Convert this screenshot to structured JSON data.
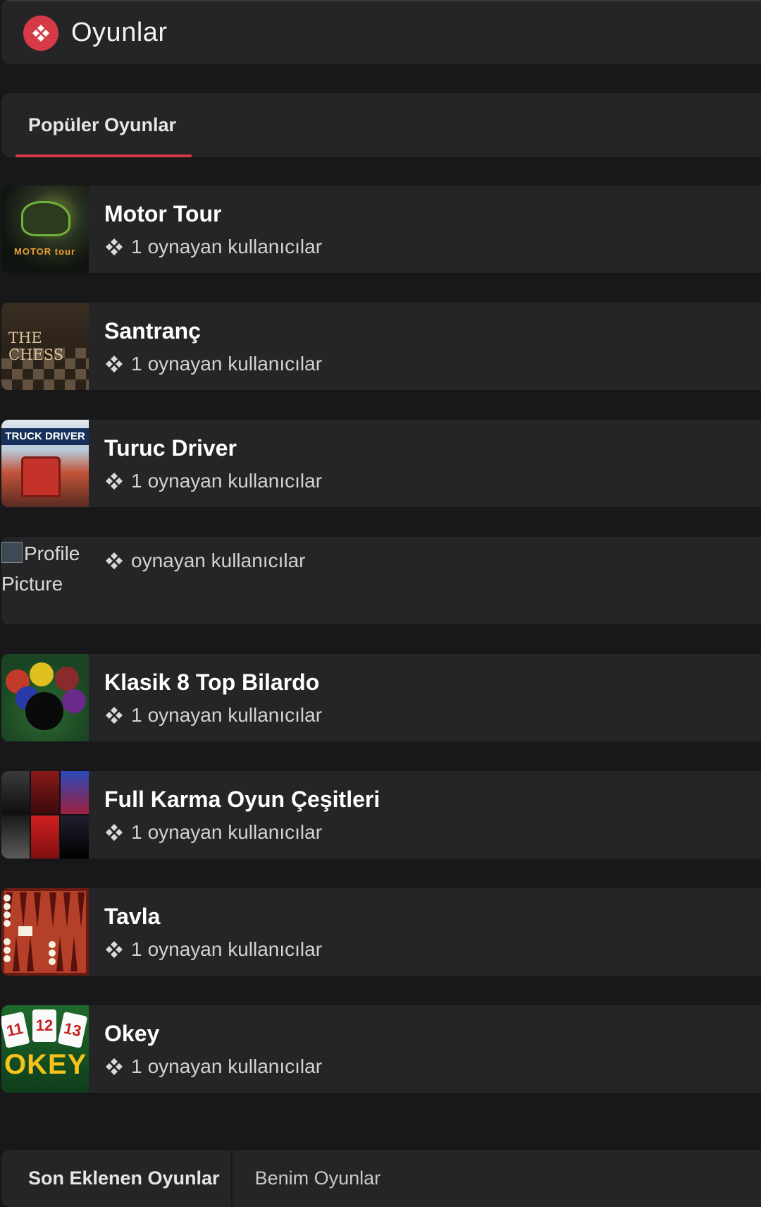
{
  "header": {
    "title": "Oyunlar",
    "icon": "gamepad-icon",
    "accent_color": "#d73a47"
  },
  "tabs_top": {
    "popular_label": "Popüler Oyunlar"
  },
  "games": [
    {
      "title": "Motor Tour",
      "count": "1",
      "players_label": "oynayan kullanıcılar"
    },
    {
      "title": "Santranç",
      "count": "1",
      "players_label": "oynayan kullanıcılar"
    },
    {
      "title": "Turuc Driver",
      "count": "1",
      "players_label": "oynayan kullanıcılar"
    },
    {
      "title": "",
      "count": "",
      "players_label": "oynayan kullanıcılar",
      "broken_image_alt": "Profile Picture"
    },
    {
      "title": "Klasik 8 Top Bilardo",
      "count": "1",
      "players_label": "oynayan kullanıcılar"
    },
    {
      "title": "Full Karma Oyun Çeşitleri",
      "count": "1",
      "players_label": "oynayan kullanıcılar"
    },
    {
      "title": "Tavla",
      "count": "1",
      "players_label": "oynayan kullanıcılar"
    },
    {
      "title": "Okey",
      "count": "1",
      "players_label": "oynayan kullanıcılar"
    }
  ],
  "thumb_text": {
    "motor": "MOTOR tour",
    "chess": "THE CHESS",
    "truck": "TRUCK DRIVER",
    "okey": "OKEY"
  },
  "okey_cards": [
    "11",
    "12",
    "13"
  ],
  "tabs_bottom": {
    "recent_label": "Son Eklenen Oyunlar",
    "mine_label": "Benim Oyunlar"
  }
}
